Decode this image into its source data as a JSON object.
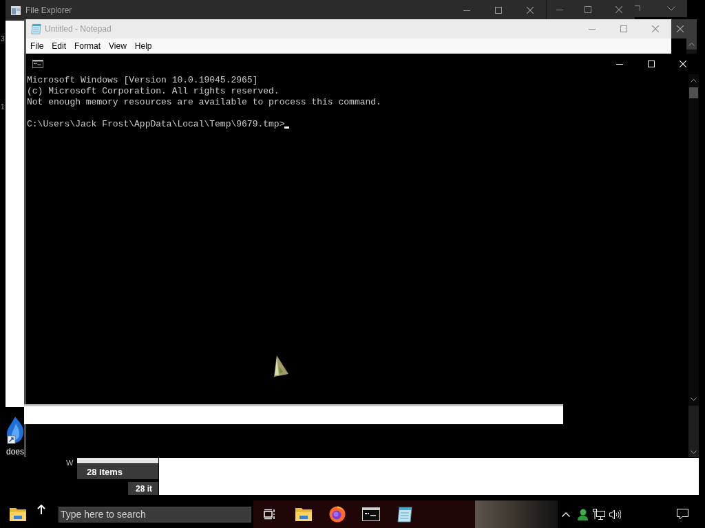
{
  "edge_fragments": [
    "3",
    "1"
  ],
  "file_explorer": {
    "title": "File Explorer"
  },
  "notepad": {
    "title": "Untitled - Notepad",
    "active": false,
    "menu": [
      "File",
      "Edit",
      "Format",
      "View",
      "Help"
    ]
  },
  "command_prompt": {
    "output": [
      "Microsoft Windows [Version 10.0.19045.2965]",
      "(c) Microsoft Corporation. All rights reserved.",
      "Not enough memory resources are available to process this command."
    ],
    "prompt": "C:\\Users\\Jack Frost\\AppData\\Local\\Temp\\9679.tmp>"
  },
  "desktop_icon": {
    "label": "does"
  },
  "explorer_fragments": {
    "partial_text": "W",
    "status": [
      "28 items",
      "28 it"
    ]
  },
  "taskbar": {
    "search": {
      "placeholder": "Type here to search"
    }
  }
}
